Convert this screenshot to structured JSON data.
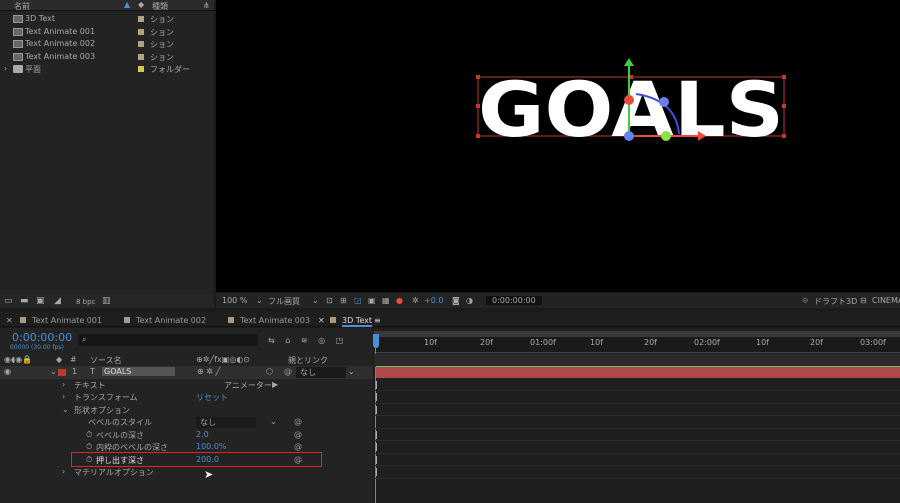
{
  "project": {
    "header": {
      "name": "名前",
      "type": "種類"
    },
    "items": [
      {
        "name": "3D Text",
        "type": "ション",
        "tag": "#b4a27a"
      },
      {
        "name": "Text Animate 001",
        "type": "ション",
        "tag": "#b4a27a"
      },
      {
        "name": "Text Animate 002",
        "type": "ション",
        "tag": "#b4a27a"
      },
      {
        "name": "Text Animate 003",
        "type": "ション",
        "tag": "#b4a27a"
      },
      {
        "name": "平面",
        "type": "フォルダー",
        "tag": "#d8c84a"
      }
    ],
    "bpc": "8 bpc"
  },
  "viewer": {
    "text": "GOALS",
    "toolbar": {
      "zoom": "100 %",
      "quality": "フル画質",
      "exposure": "+0.0",
      "timecode": "0:00:00:00",
      "renderer": "ドラフト3D",
      "cinema": "CINEMA"
    }
  },
  "tabs": [
    "Text Animate 001",
    "Text Animate 002",
    "Text Animate 003",
    "3D Text"
  ],
  "timeline": {
    "timecode": "0:00:00:00",
    "frames": "00000 (30.00 fps)",
    "columns": {
      "source": "ソース名",
      "parent": "親とリンク"
    },
    "layer": {
      "index": "1",
      "name": "GOALS",
      "parent": "なし"
    },
    "props": {
      "text": "テキスト",
      "animator": "アニメーター",
      "transform": "トランスフォーム",
      "reset": "リセット",
      "geometry": "形状オプション",
      "bevel_style": "ベベルのスタイル",
      "bevel_style_val": "なし",
      "bevel_depth": "ベベルの深さ",
      "bevel_depth_val": "2.0",
      "inner_bevel": "内枠のベベルの深さ",
      "inner_bevel_val": "100.0%",
      "extrude": "押し出す深さ",
      "extrude_val": "200.0",
      "material": "マテリアルオプション"
    },
    "ruler": [
      "10f",
      "20f",
      "01:00f",
      "10f",
      "20f",
      "02:00f",
      "10f",
      "20f",
      "03:00f"
    ],
    "layer_bar_color": "#b04a4a"
  }
}
